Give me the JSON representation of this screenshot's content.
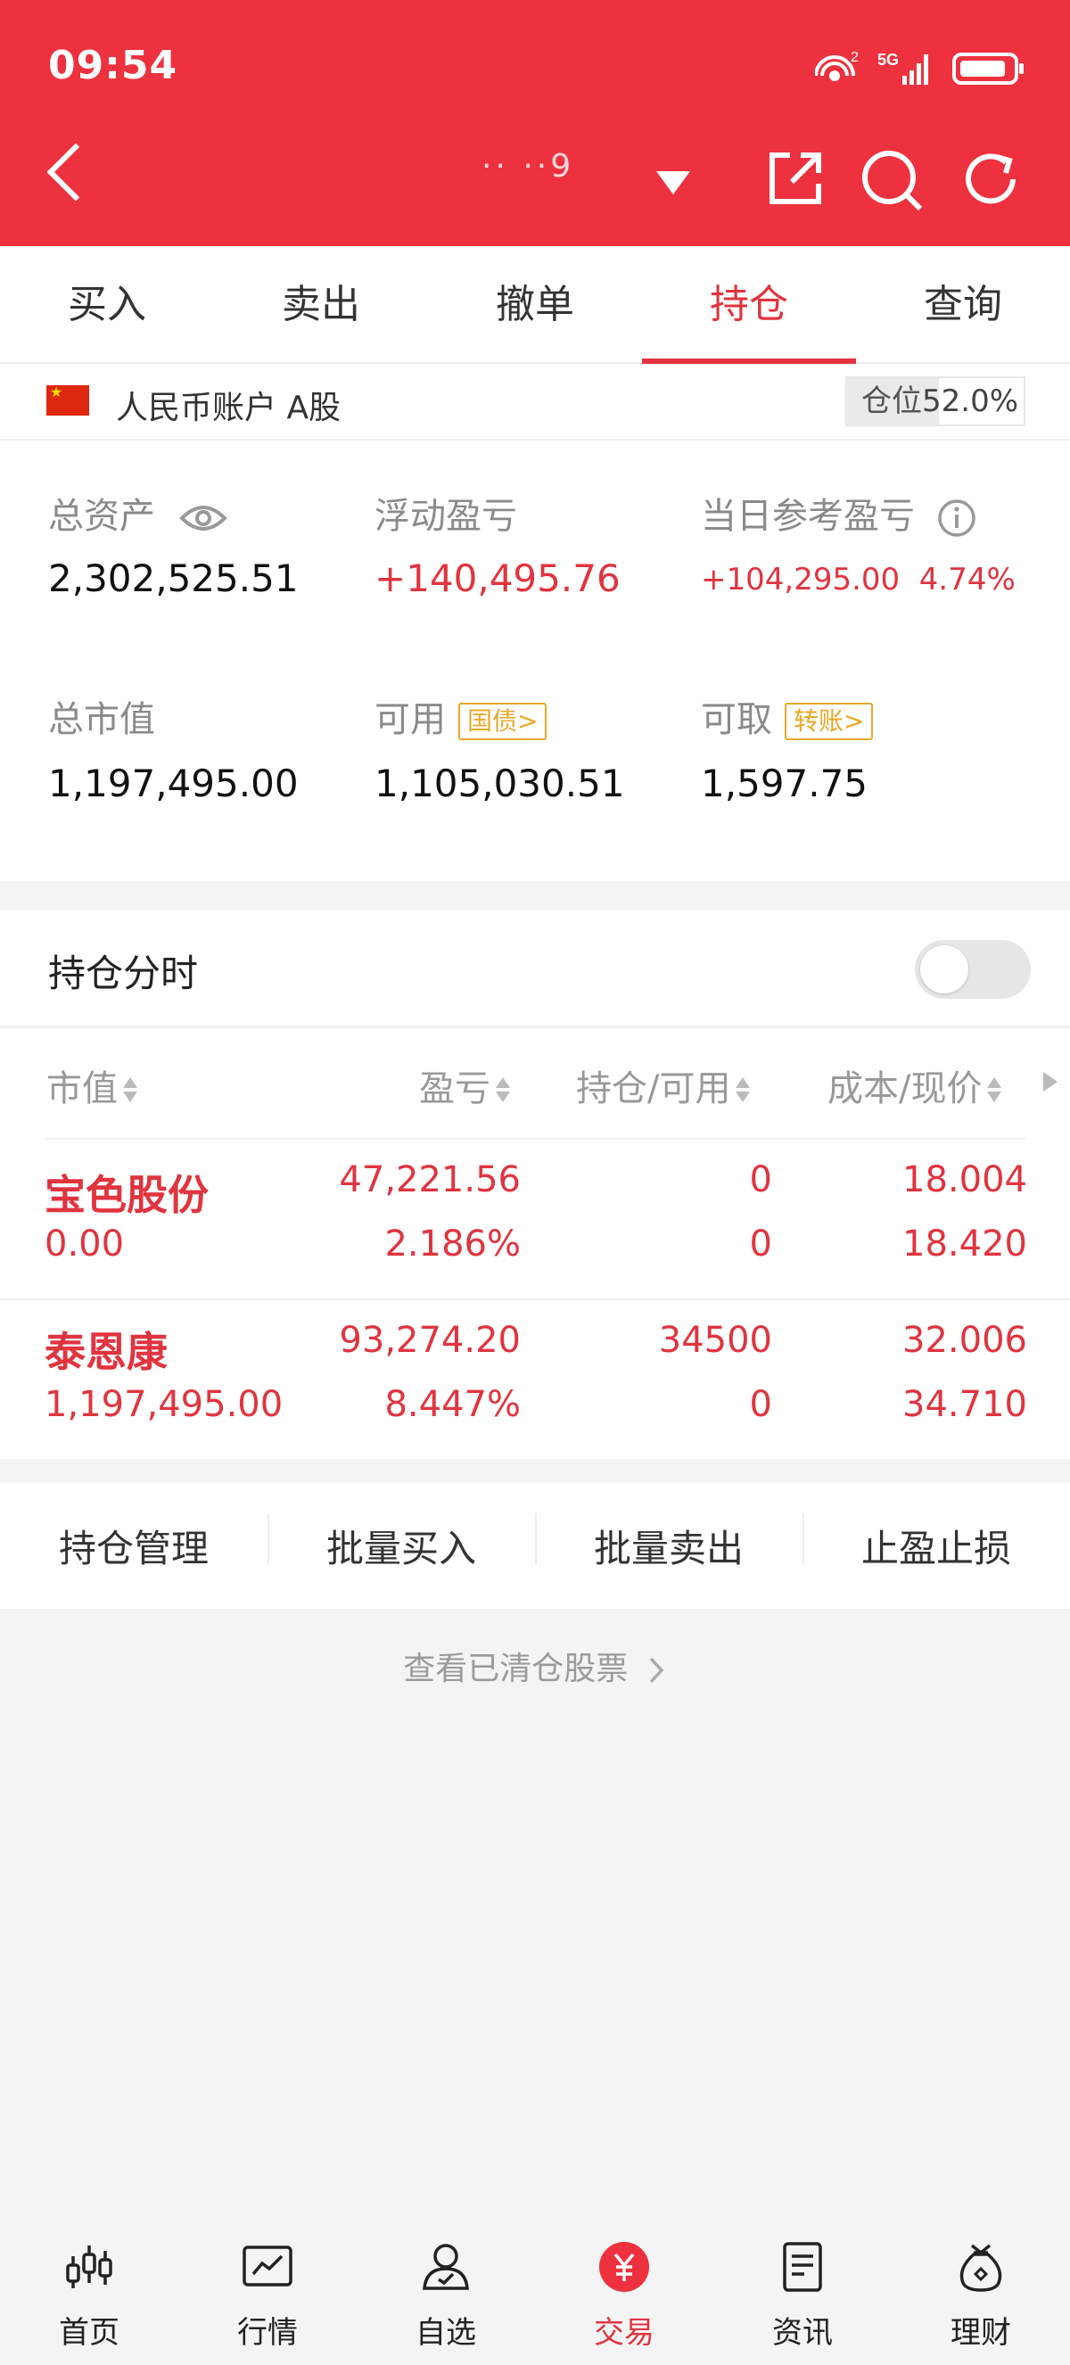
{
  "status_bar": {
    "time": "09:54",
    "network": "5G",
    "sim": "2"
  },
  "header": {
    "account_masked": "·· ··9"
  },
  "tabs": [
    {
      "label": "买入"
    },
    {
      "label": "卖出"
    },
    {
      "label": "撤单"
    },
    {
      "label": "持仓",
      "active": true
    },
    {
      "label": "查询"
    }
  ],
  "account": {
    "label": "人民币账户 A股",
    "position_label": "仓位",
    "position_value": "52.0%",
    "position_fraction": 0.52
  },
  "summary": {
    "total_assets_label": "总资产",
    "total_assets": "2,302,525.51",
    "floating_pl_label": "浮动盈亏",
    "floating_pl": "+140,495.76",
    "daily_pl_label": "当日参考盈亏",
    "daily_pl": "+104,295.00",
    "daily_pl_pct": "4.74%",
    "market_value_label": "总市值",
    "market_value": "1,197,495.00",
    "available_label": "可用",
    "available_tag": "国债>",
    "available": "1,105,030.51",
    "withdrawable_label": "可取",
    "withdrawable_tag": "转账>",
    "withdrawable": "1,597.75"
  },
  "ticker_toggle": {
    "label": "持仓分时",
    "enabled": false
  },
  "table": {
    "headers": [
      "市值",
      "盈亏",
      "持仓/可用",
      "成本/现价"
    ],
    "rows": [
      {
        "name": "宝色股份",
        "market_value": "0.00",
        "pl": "47,221.56",
        "pl_pct": "2.186%",
        "holding": "0",
        "available": "0",
        "cost": "18.004",
        "price": "18.420"
      },
      {
        "name": "泰恩康",
        "market_value": "1,197,495.00",
        "pl": "93,274.20",
        "pl_pct": "8.447%",
        "holding": "34500",
        "available": "0",
        "cost": "32.006",
        "price": "34.710"
      }
    ]
  },
  "actions": [
    {
      "label": "持仓管理"
    },
    {
      "label": "批量买入"
    },
    {
      "label": "批量卖出"
    },
    {
      "label": "止盈止损"
    }
  ],
  "cleared_link": "查看已清仓股票",
  "bottom_nav": [
    {
      "label": "首页",
      "icon": "candlestick-icon"
    },
    {
      "label": "行情",
      "icon": "chart-icon"
    },
    {
      "label": "自选",
      "icon": "user-star-icon"
    },
    {
      "label": "交易",
      "icon": "yuan-icon",
      "active": true
    },
    {
      "label": "资讯",
      "icon": "document-icon"
    },
    {
      "label": "理财",
      "icon": "money-bag-icon"
    }
  ],
  "colors": {
    "brand": "#ee313e",
    "up": "#e0343f",
    "tag": "#e8a829"
  }
}
